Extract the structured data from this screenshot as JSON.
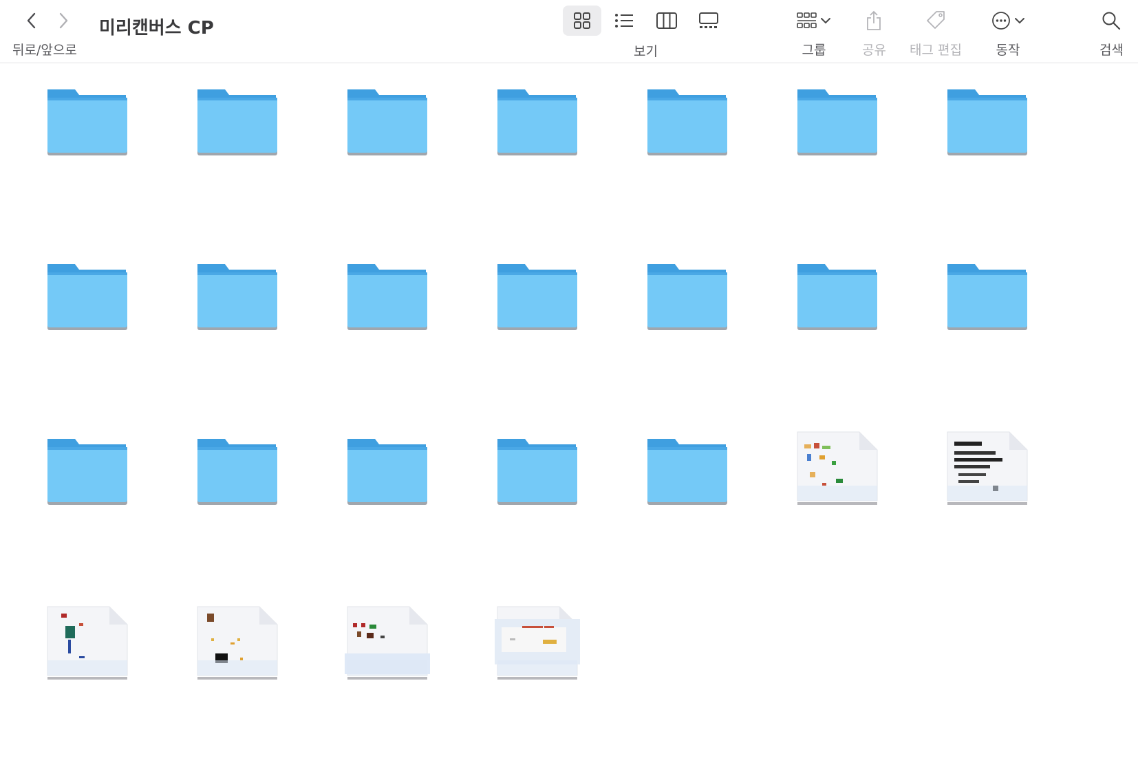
{
  "toolbar": {
    "nav_label": "뒤로/앞으로",
    "title": "미리캔버스 CP",
    "view_label": "보기",
    "group_label": "그룹",
    "share_label": "공유",
    "tags_label": "태그 편집",
    "action_label": "동작",
    "search_label": "검색",
    "active_view": "icon"
  },
  "colors": {
    "folder_body": "#74c9f7",
    "folder_tab": "#3f9fe0",
    "folder_shadow": "#a0a6ad",
    "doc_paper": "#f4f5f8"
  },
  "items": [
    {
      "kind": "folder",
      "name": ""
    },
    {
      "kind": "folder",
      "name": ""
    },
    {
      "kind": "folder",
      "name": ""
    },
    {
      "kind": "folder",
      "name": ""
    },
    {
      "kind": "folder",
      "name": ""
    },
    {
      "kind": "folder",
      "name": ""
    },
    {
      "kind": "folder",
      "name": ""
    },
    {
      "kind": "folder",
      "name": ""
    },
    {
      "kind": "folder",
      "name": ""
    },
    {
      "kind": "folder",
      "name": ""
    },
    {
      "kind": "folder",
      "name": ""
    },
    {
      "kind": "folder",
      "name": ""
    },
    {
      "kind": "folder",
      "name": ""
    },
    {
      "kind": "folder",
      "name": ""
    },
    {
      "kind": "folder",
      "name": ""
    },
    {
      "kind": "folder",
      "name": ""
    },
    {
      "kind": "folder",
      "name": ""
    },
    {
      "kind": "folder",
      "name": ""
    },
    {
      "kind": "folder",
      "name": ""
    },
    {
      "kind": "document",
      "name": "",
      "preview": "chart"
    },
    {
      "kind": "document",
      "name": "",
      "preview": "text"
    },
    {
      "kind": "document",
      "name": "",
      "preview": "poster"
    },
    {
      "kind": "document",
      "name": "",
      "preview": "sparse"
    },
    {
      "kind": "document",
      "name": "",
      "preview": "card"
    },
    {
      "kind": "document",
      "name": "",
      "preview": "banner"
    }
  ]
}
